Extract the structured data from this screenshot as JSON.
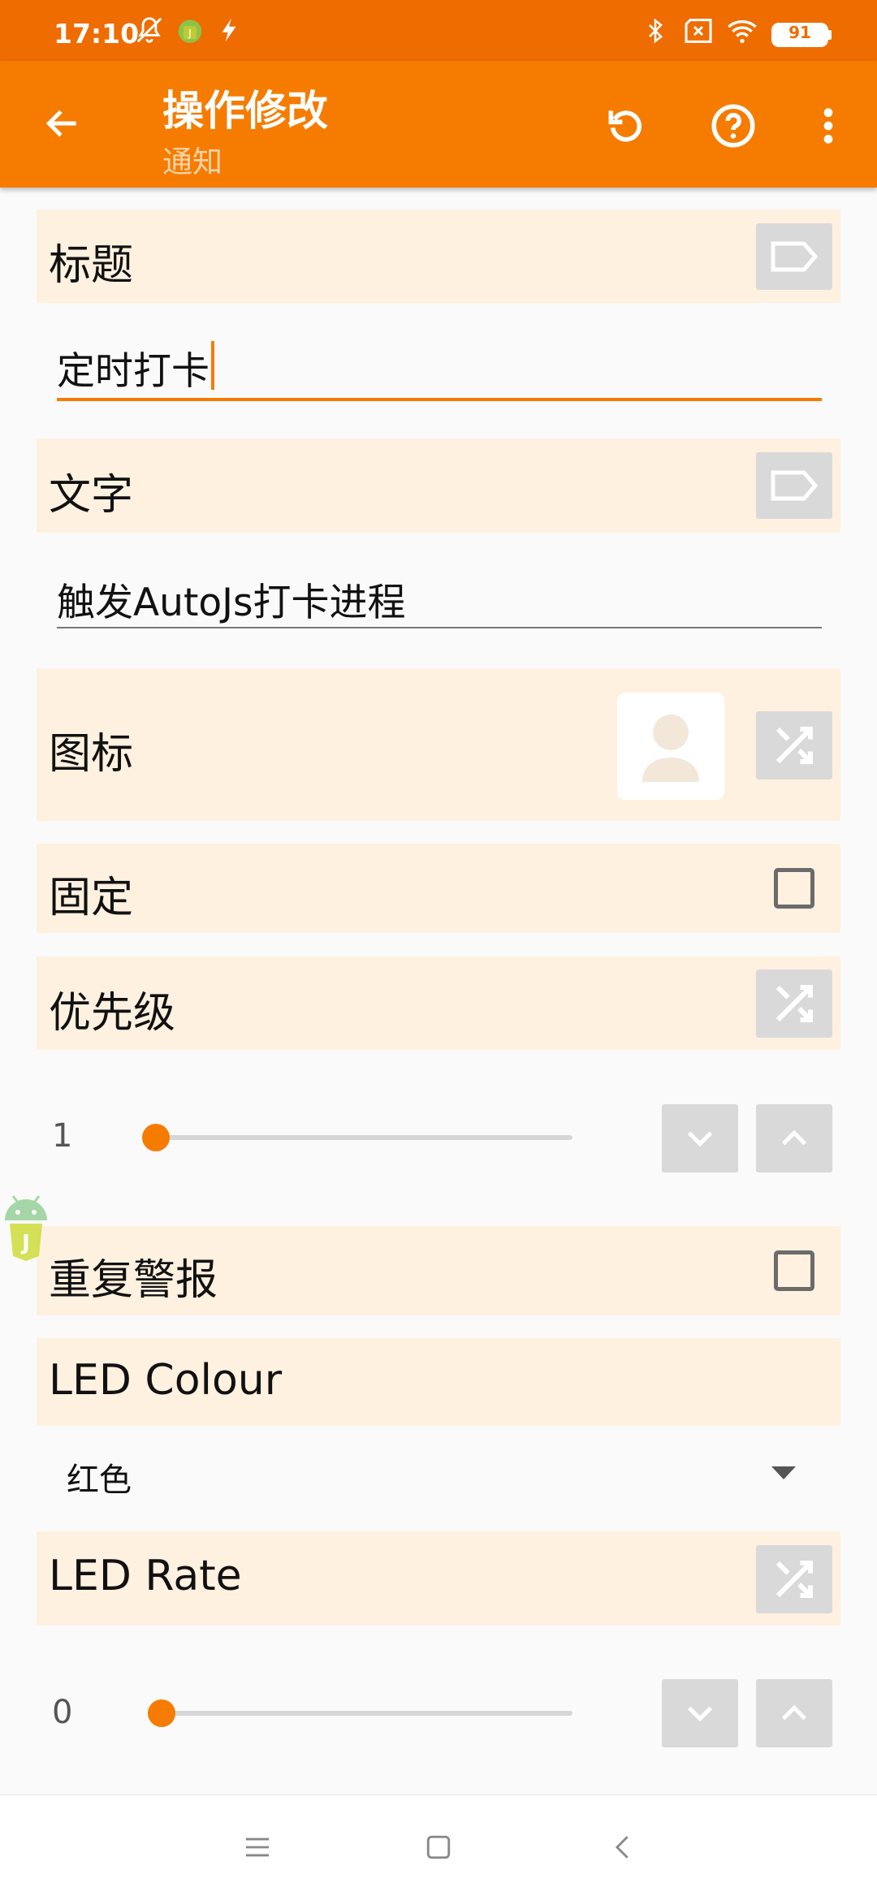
{
  "status_bar": {
    "time": "17:10",
    "battery": "91",
    "icons": [
      "muted-bell-icon",
      "autojs-icon",
      "flash-icon",
      "bluetooth-icon",
      "no-sim-icon",
      "wifi-icon",
      "battery-icon"
    ]
  },
  "app_bar": {
    "title": "操作修改",
    "subtitle": "通知",
    "icons": [
      "back-arrow-icon",
      "refresh-icon",
      "help-icon",
      "more-vert-icon"
    ]
  },
  "fields": {
    "title_label": "标题",
    "title_value": "定时打卡",
    "text_label": "文字",
    "text_value": "触发AutoJs打卡进程",
    "icon_label": "图标",
    "pinned_label": "固定",
    "priority_label": "优先级",
    "priority_value": "1",
    "repeat_alert_label": "重复警报",
    "led_colour_label": "LED Colour",
    "led_colour_value": "红色",
    "led_rate_label": "LED Rate",
    "led_rate_value": "0"
  },
  "states": {
    "pinned_checked": false,
    "repeat_alert_checked": false,
    "priority_slider_fraction": 0.0,
    "led_rate_slider_fraction": 0.0
  },
  "colors": {
    "status_bar": "#ef6c00",
    "app_bar": "#f57c00",
    "accent": "#f57c00",
    "row_background": "#fff1e0"
  },
  "nav_bar": {
    "icons": [
      "menu-icon",
      "home-icon",
      "back-icon"
    ]
  }
}
